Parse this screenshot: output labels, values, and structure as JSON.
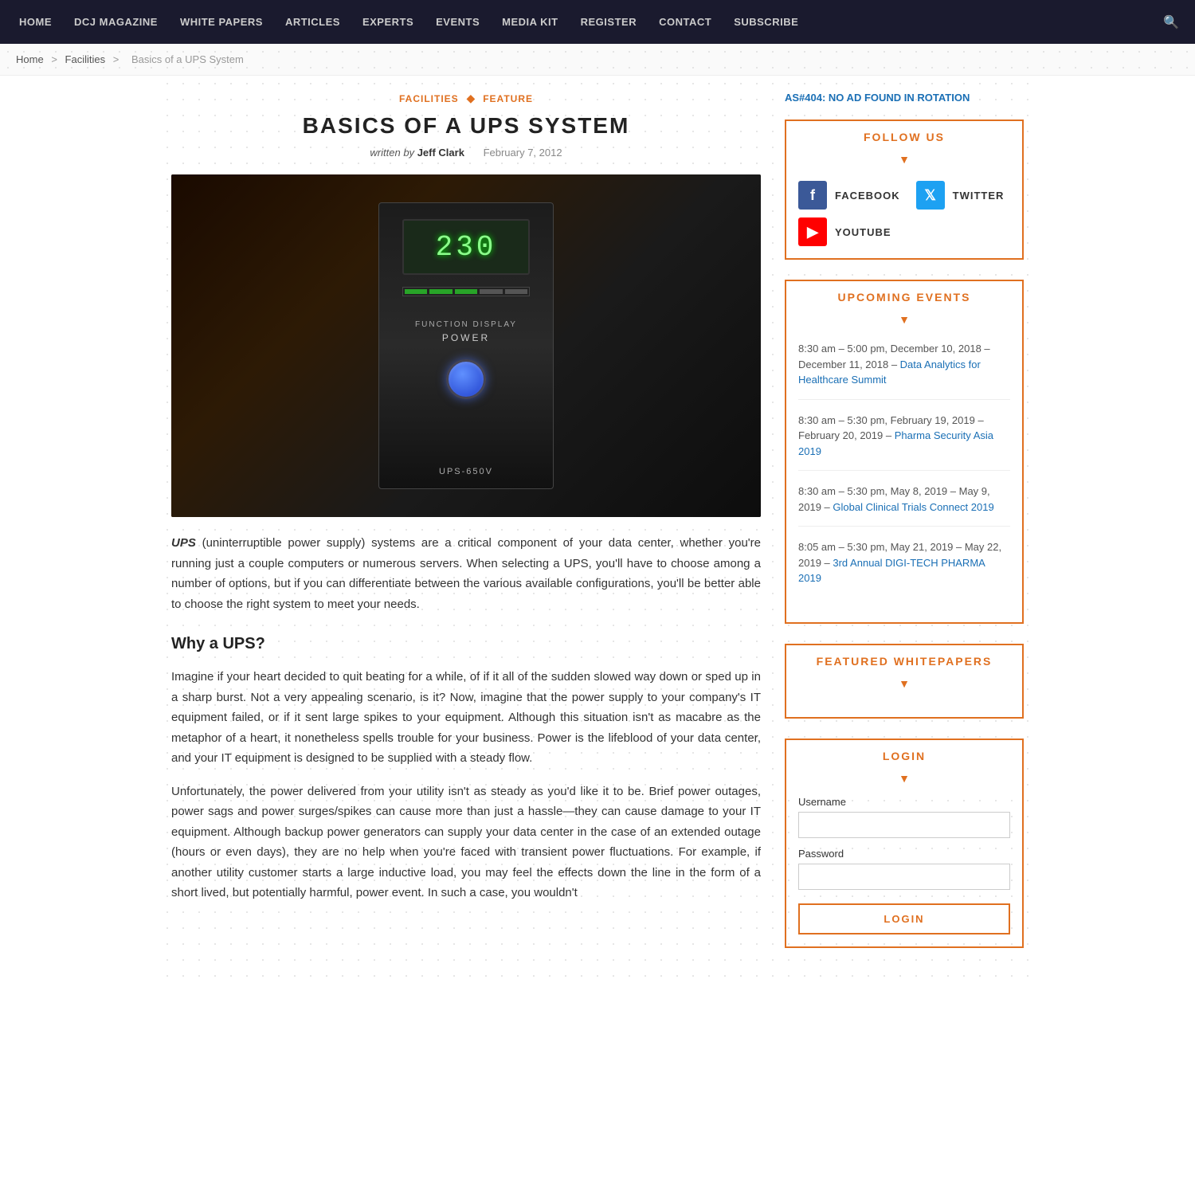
{
  "nav": {
    "items": [
      {
        "label": "HOME",
        "href": "#"
      },
      {
        "label": "DCJ MAGAZINE",
        "href": "#"
      },
      {
        "label": "WHITE PAPERS",
        "href": "#"
      },
      {
        "label": "ARTICLES",
        "href": "#"
      },
      {
        "label": "EXPERTS",
        "href": "#"
      },
      {
        "label": "EVENTS",
        "href": "#"
      },
      {
        "label": "MEDIA KIT",
        "href": "#"
      },
      {
        "label": "REGISTER",
        "href": "#"
      },
      {
        "label": "CONTACT",
        "href": "#"
      },
      {
        "label": "SUBSCRIBE",
        "href": "#"
      }
    ]
  },
  "breadcrumb": {
    "items": [
      {
        "label": "Home",
        "href": "#"
      },
      {
        "label": "Facilities",
        "href": "#"
      },
      {
        "label": "Basics of a UPS System",
        "href": "#"
      }
    ]
  },
  "article": {
    "tag1": "FACILITIES",
    "tag2": "FEATURE",
    "title": "BASICS OF A UPS SYSTEM",
    "written_by": "written by",
    "author": "Jeff Clark",
    "date": "February 7, 2012",
    "ups_display": "230",
    "ups_model": "UPS-650V",
    "ups_func_label": "FUNCTION DISPLAY",
    "ups_power_label": "POWER",
    "body_p1_italic": "UPS",
    "body_p1": " (uninterruptible power supply) systems are a critical component of your data center, whether you're running just a couple computers or numerous servers. When selecting a UPS, you'll have to choose among a number of options, but if you can differentiate between the various available configurations, you'll be better able to choose the right system to meet your needs.",
    "h2_why": "Why a UPS?",
    "body_p2": "Imagine if your heart decided to quit beating for a while, of if it all of the sudden slowed way down or sped up in a sharp burst. Not a very appealing scenario, is it? Now, imagine that the power supply to your company's IT equipment failed, or if it sent large spikes to your equipment. Although this situation isn't as macabre as the metaphor of a heart, it nonetheless spells trouble for your business. Power is the lifeblood of your data center, and your IT equipment is designed to be supplied with a steady flow.",
    "body_p3": "Unfortunately, the power delivered from your utility isn't as steady as you'd like it to be. Brief power outages, power sags and power surges/spikes can cause more than just a hassle—they can cause damage to your IT equipment. Although backup power generators can supply your data center in the case of an extended outage (hours or even days), they are no help when you're faced with transient power fluctuations. For example, if another utility customer starts a large inductive load, you may feel the effects down the line in the form of a short lived, but potentially harmful, power event. In such a case, you wouldn't"
  },
  "sidebar": {
    "ad_text": "AS#404: NO AD FOUND IN ROTATION",
    "follow_us": {
      "title": "FOLLOW US",
      "facebook_label": "FACEBOOK",
      "twitter_label": "TWITTER",
      "youtube_label": "YOUTUBE"
    },
    "upcoming_events": {
      "title": "UPCOMING EVENTS",
      "events": [
        {
          "time": "8:30 am – 5:00 pm, December 10, 2018 – December 11, 2018 – ",
          "link_text": "Data Analytics for Healthcare Summit",
          "link_href": "#"
        },
        {
          "time": "8:30 am – 5:30 pm, February 19, 2019 – February 20, 2019 – ",
          "link_text": "Pharma Security Asia 2019",
          "link_href": "#"
        },
        {
          "time": "8:30 am – 5:30 pm, May 8, 2019 – May 9, 2019 – ",
          "link_text": "Global Clinical Trials Connect 2019",
          "link_href": "#"
        },
        {
          "time": "8:05 am – 5:30 pm, May 21, 2019 – May 22, 2019 – ",
          "link_text": "3rd Annual DIGI-TECH PHARMA 2019",
          "link_href": "#"
        }
      ]
    },
    "featured_whitepapers": {
      "title": "FEATURED WHITEPAPERS"
    },
    "login": {
      "title": "LOGIN",
      "username_label": "Username",
      "password_label": "Password",
      "button_label": "LOGIN"
    }
  }
}
